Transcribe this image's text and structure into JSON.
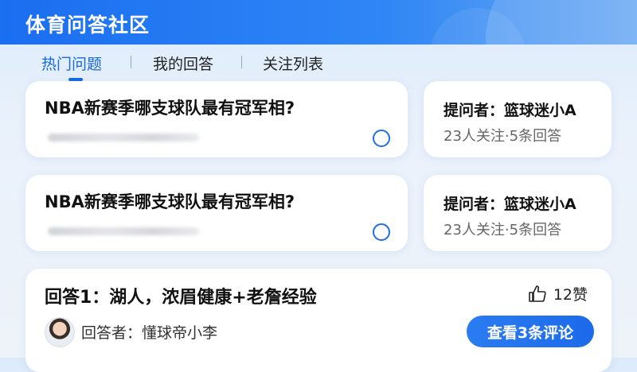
{
  "app": {
    "title": "体育问答社区"
  },
  "tabs": [
    {
      "label": "热门问题",
      "active": true
    },
    {
      "label": "我的回答",
      "active": false
    },
    {
      "label": "关注列表",
      "active": false
    }
  ],
  "questions": [
    {
      "title": "NBA新赛季哪支球队最有冠军相?",
      "asker": "提问者：篮球迷小A",
      "stats": "23人关注·5条回答"
    },
    {
      "title": "NBA新赛季哪支球队最有冠军相?",
      "asker": "提问者：篮球迷小A",
      "stats": "23人关注·5条回答"
    }
  ],
  "answer": {
    "title": "回答1：湖人，浓眉健康+老詹经验",
    "likes": "12赞",
    "answerer": "回答者：懂球帝小李",
    "comment_button": "查看3条评论"
  },
  "colors": {
    "accent": "#1668e3",
    "header": "#1a6ef0"
  },
  "icons": {
    "like": "thumbs-up-icon",
    "radio": "radio-icon",
    "avatar": "avatar"
  }
}
